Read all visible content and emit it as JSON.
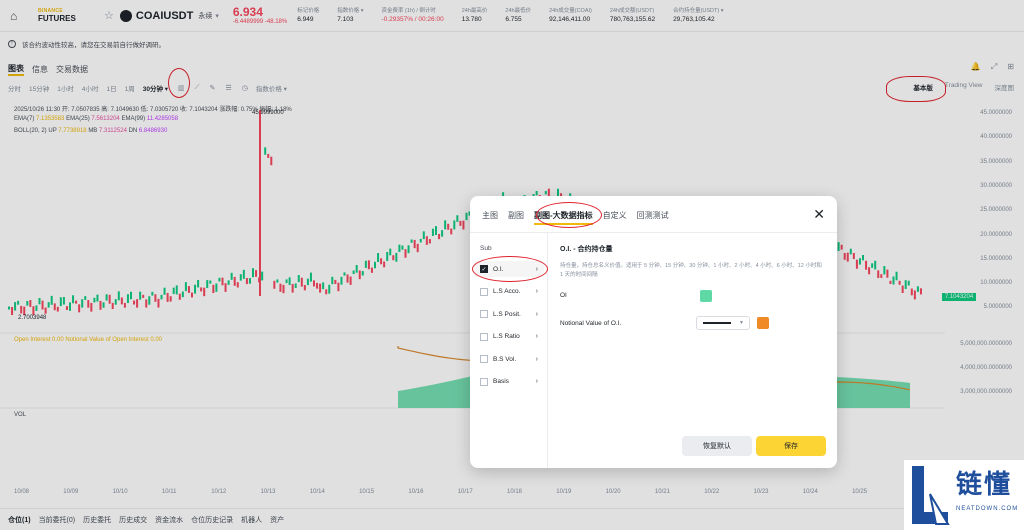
{
  "header": {
    "brand_top": "BINANCE",
    "brand_bottom": "FUTURES",
    "symbol": "COAIUSDT",
    "contract_type": "永续",
    "last_price": "6.934",
    "change": "-6.4489999 -48.18%",
    "stats": [
      {
        "label": "标记价格",
        "value": "6.949",
        "red": false
      },
      {
        "label": "指数价格 ▾",
        "value": "7.103",
        "red": false
      },
      {
        "label": "资金费率 (1h) / 倒计时",
        "value": "-0.29357% / 00:26:00",
        "red": true
      },
      {
        "label": "24h最高价",
        "value": "13.780",
        "red": false
      },
      {
        "label": "24h最低价",
        "value": "6.755",
        "red": false
      },
      {
        "label": "24h成交量(COAI)",
        "value": "92,146,411.00",
        "red": false
      },
      {
        "label": "24h成交额(USDT)",
        "value": "780,763,155.62",
        "red": false
      },
      {
        "label": "合约持仓量(USDT) ▾",
        "value": "29,763,105.42",
        "red": false
      }
    ]
  },
  "notice": "该合约波动性较高，请您在交易前自行做好调研。",
  "chart_tabs": [
    "图表",
    "信息",
    "交易数据"
  ],
  "timeframes": [
    "分时",
    "15分钟",
    "1小时",
    "4小时",
    "1日",
    "1周",
    "30分钟 ▾"
  ],
  "indicators_label": "指数价格 ▾",
  "views": [
    "基本版",
    "Trading View",
    "深度图"
  ],
  "legend": {
    "ohlc": "2025/10/26 11:30  开: 7.0507835  高: 7.1049630  低: 7.0305720  收: 7.1043204  涨跌幅: 0.75%  振幅: 1.18%",
    "ema": [
      "EMA(7)",
      "7.1353583",
      "EMA(25)",
      "7.5613204",
      "EMA(99)",
      "11.4285058"
    ],
    "boll": [
      "BOLL(20, 2)",
      "UP",
      "7.7738918",
      "MB",
      "7.3112524",
      "DN",
      "6.8486930"
    ],
    "oi": [
      "Open Interest",
      "0.00",
      "Notional Value of Open Interest",
      "0.00"
    ],
    "vol": "VOL"
  },
  "high_marker": "45.9999000",
  "low_marker": "2.7003948",
  "y_axis_price": [
    "45.0000000",
    "40.0000000",
    "35.0000000",
    "30.0000000",
    "25.0000000",
    "20.0000000",
    "15.0000000",
    "10.0000000",
    "5.0000000"
  ],
  "price_tag": "7.1043204",
  "y_axis_oi": [
    "5,000,000.0000000",
    "4,000,000.0000000",
    "3,000,000.0000000"
  ],
  "x_axis": [
    "10/08",
    "10/09",
    "10/10",
    "10/11",
    "10/12",
    "10/13",
    "10/14",
    "10/15",
    "10/16",
    "10/17",
    "10/18",
    "10/19",
    "10/20",
    "10/21",
    "10/22",
    "10/23",
    "10/24",
    "10/25"
  ],
  "bottom_tabs": [
    "仓位(1)",
    "当前委托(0)",
    "历史委托",
    "历史成交",
    "资金流水",
    "仓位历史记录",
    "机器人",
    "资产"
  ],
  "modal": {
    "tabs": [
      "主图",
      "副图",
      "副图-大数据指标",
      "自定义",
      "回测测试"
    ],
    "sub_label": "Sub",
    "items": [
      {
        "label": "O.I.",
        "checked": true
      },
      {
        "label": "L.S Acco.",
        "checked": false
      },
      {
        "label": "L.S Posit.",
        "checked": false
      },
      {
        "label": "L.S Ratio",
        "checked": false
      },
      {
        "label": "B.S Vol.",
        "checked": false
      },
      {
        "label": "Basis",
        "checked": false
      }
    ],
    "title": "O.I. - 合约持仓量",
    "desc": "持仓量，持仓总名义价值。适用于 5 分钟、15 分钟、30 分钟、1 小时、2 小时、4 小时、6 小时、12 小时和 1 天的时间间隔",
    "rows": [
      {
        "label": "OI",
        "color": "#5ed9a5"
      },
      {
        "label": "Notional Value of O.I.",
        "color": "#f08a24"
      }
    ],
    "reset": "恢复默认",
    "save": "保存"
  },
  "watermark": {
    "cn": "链懂",
    "en": "NEATDOWN.COM"
  },
  "colors": {
    "up": "#0ecb81",
    "down": "#f6465d",
    "accent": "#f0b90b",
    "oi_fill": "#5ed9a5",
    "notional": "#e08a2c"
  }
}
